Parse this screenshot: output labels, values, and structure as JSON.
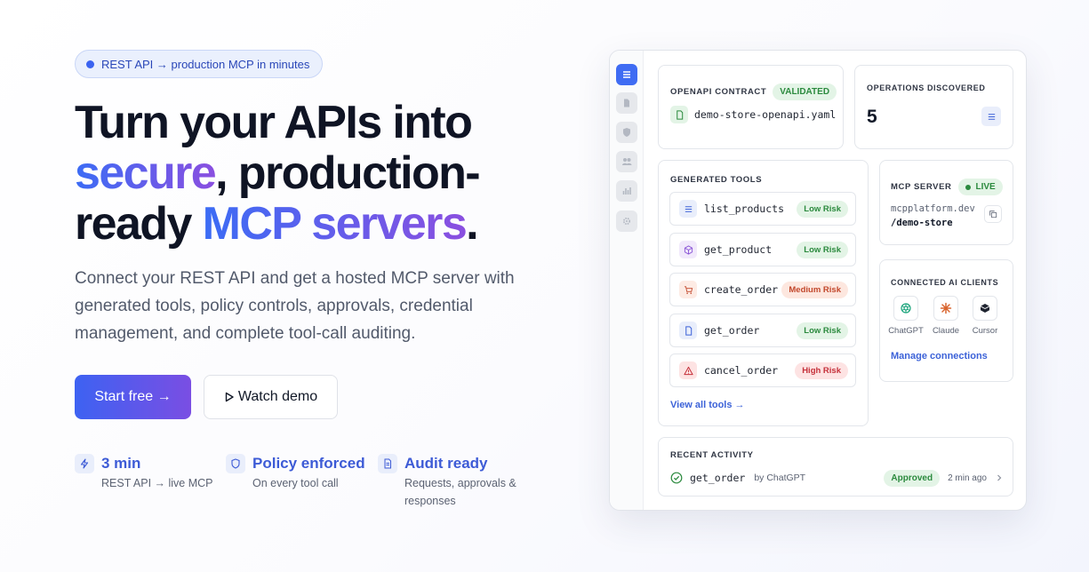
{
  "hero": {
    "badge": "REST API → production MCP in minutes",
    "headline": {
      "line1": "Turn your APIs into",
      "secure": "secure",
      "line2_rest": ", production-",
      "line3_start": "ready ",
      "mcp_servers": "MCP servers",
      "period": "."
    },
    "subhead": "Connect your REST API and get a hosted MCP server with generated tools, policy controls, approvals, credential management, and complete tool-call auditing.",
    "primary_cta": "Start free →",
    "secondary_cta_icon": "play-outline-icon",
    "secondary_cta": "Watch demo",
    "features": [
      {
        "icon": "bolt-icon",
        "title": "3 min",
        "desc": "REST API → live MCP"
      },
      {
        "icon": "shield-icon",
        "title": "Policy enforced",
        "desc": "On every tool call"
      },
      {
        "icon": "document-icon",
        "title": "Audit ready",
        "desc": "Requests, approvals & responses"
      }
    ]
  },
  "dashboard": {
    "rail_icons": [
      "list-icon",
      "pages-icon",
      "shield-icon",
      "users-icon",
      "chart-icon",
      "gear-icon"
    ],
    "openapi": {
      "label": "OPENAPI CONTRACT",
      "status": "VALIDATED",
      "file": "demo-store-openapi.yaml"
    },
    "operations": {
      "label": "OPERATIONS DISCOVERED",
      "count": "5"
    },
    "tools": {
      "label": "GENERATED TOOLS",
      "items": [
        {
          "name": "list_products",
          "risk": "Low Risk",
          "level": "low",
          "icon": "list-icon"
        },
        {
          "name": "get_product",
          "risk": "Low Risk",
          "level": "low",
          "icon": "box-icon"
        },
        {
          "name": "create_order",
          "risk": "Medium Risk",
          "level": "medium",
          "icon": "cart-icon"
        },
        {
          "name": "get_order",
          "risk": "Low Risk",
          "level": "low",
          "icon": "document-icon"
        },
        {
          "name": "cancel_order",
          "risk": "High Risk",
          "level": "high",
          "icon": "warning-icon"
        }
      ],
      "view_all": "View all tools →"
    },
    "mcp_server": {
      "label": "MCP SERVER",
      "status": "LIVE",
      "host": "mcpplatform.dev",
      "path": "/demo-store"
    },
    "clients": {
      "label": "CONNECTED AI CLIENTS",
      "items": [
        {
          "name": "ChatGPT",
          "icon": "chatgpt-icon"
        },
        {
          "name": "Claude",
          "icon": "claude-icon"
        },
        {
          "name": "Cursor",
          "icon": "cursor-icon"
        }
      ],
      "manage": "Manage connections"
    },
    "activity": {
      "label": "RECENT ACTIVITY",
      "tool": "get_order",
      "by": "by ChatGPT",
      "status": "Approved",
      "time": "2 min ago"
    }
  }
}
